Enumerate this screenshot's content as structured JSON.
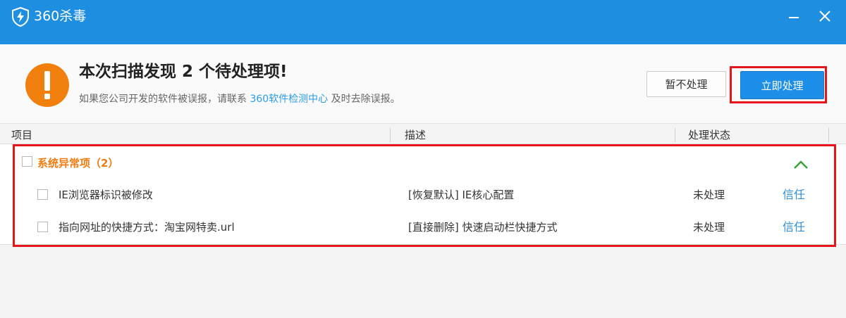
{
  "window": {
    "title": "360杀毒",
    "logo_icon": "shield-bolt-icon",
    "accent_color": "#1e8fe0"
  },
  "header": {
    "icon": "warning-icon",
    "headline": "本次扫描发现 2 个待处理项!",
    "sub_prefix": "如果您公司开发的软件被误报，请联系",
    "sub_link": "360软件检测中心",
    "sub_suffix": "及时去除误报。",
    "ignore_button": "暂不处理",
    "process_button": "立即处理"
  },
  "columns": {
    "item": "项目",
    "description": "描述",
    "status": "处理状态"
  },
  "group": {
    "label": "系统异常项（2）",
    "expanded": true,
    "rows": [
      {
        "name": "IE浏览器标识被修改",
        "description": "[恢复默认] IE核心配置",
        "status": "未处理",
        "action": "信任"
      },
      {
        "name": "指向网址的快捷方式：淘宝网特卖.url",
        "description": "[直接删除] 快速启动栏快捷方式",
        "status": "未处理",
        "action": "信任"
      }
    ]
  }
}
